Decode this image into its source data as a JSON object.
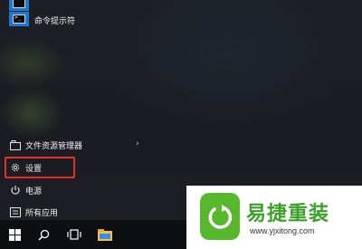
{
  "start_menu": {
    "apps": [
      {
        "label": "",
        "icon": "app-tile-icon"
      },
      {
        "label": "命令提示符",
        "icon": "command-prompt-icon"
      }
    ],
    "system_items": [
      {
        "label": "文件资源管理器",
        "icon": "file-explorer-icon",
        "has_submenu": true
      },
      {
        "label": "设置",
        "icon": "gear-icon",
        "highlighted": true
      },
      {
        "label": "电源",
        "icon": "power-icon"
      },
      {
        "label": "所有应用",
        "icon": "all-apps-icon"
      }
    ],
    "highlight_color": "#e2302c"
  },
  "taskbar": {
    "items": [
      "windows-start-icon",
      "search-icon",
      "task-view-icon",
      "file-explorer-icon"
    ]
  },
  "watermark": {
    "title": "易捷重装",
    "url": "www.yjxitong.com",
    "brand_color": "#58b82d"
  }
}
